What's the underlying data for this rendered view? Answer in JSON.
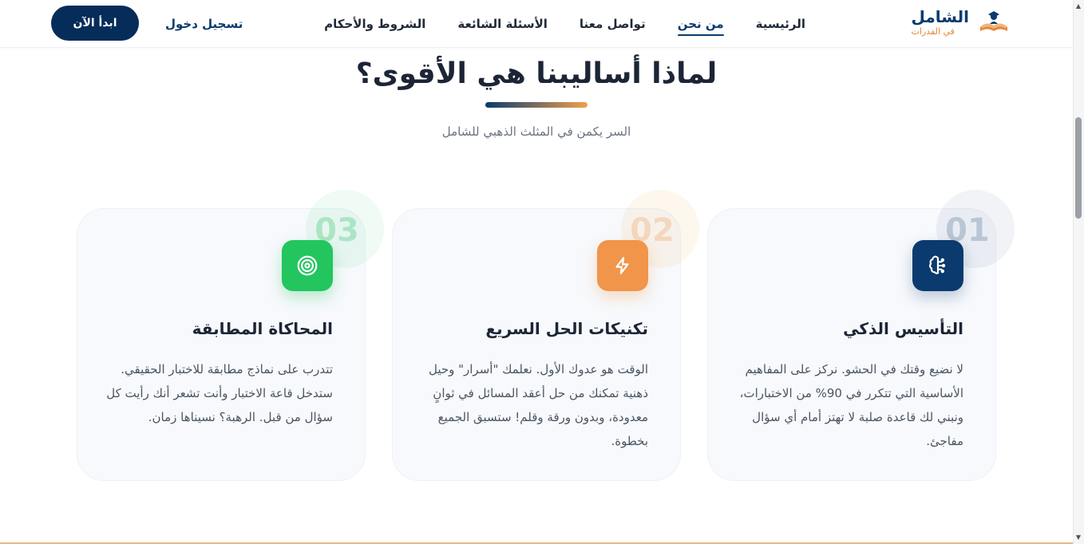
{
  "nav": {
    "logo_main": "الشامل",
    "logo_sub": "في القدرات",
    "links": [
      {
        "label": "الرئيسية"
      },
      {
        "label": "من نحن"
      },
      {
        "label": "تواصل معنا"
      },
      {
        "label": "الأسئلة الشائعة"
      },
      {
        "label": "الشروط والأحكام"
      }
    ],
    "active_link": "من نحن",
    "login": "تسجيل دخول",
    "start": "ابدأ الآن"
  },
  "section": {
    "title": "لماذا أساليبنا هي الأقوى؟",
    "subtitle": "السر يكمن في المثلث الذهبي للشامل"
  },
  "cards": [
    {
      "number": "01",
      "icon": "brain-icon",
      "color": "#0b3a6e",
      "title": "التأسيس الذكي",
      "body": "لا نضيع وقتك في الحشو. نركز على المفاهيم الأساسية التي تتكرر في 90% من الاختبارات، ونبني لك قاعدة صلبة لا تهتز أمام أي سؤال مفاجئ."
    },
    {
      "number": "02",
      "icon": "lightning-icon",
      "color": "#f0954a",
      "title": "تكنيكات الحل السريع",
      "body": "الوقت هو عدوك الأول. نعلمك \"أسرار\" وحيل ذهنية تمكنك من حل أعقد المسائل في ثوانٍ معدودة، وبدون ورقة وقلم! ستسبق الجميع بخطوة."
    },
    {
      "number": "03",
      "icon": "target-icon",
      "color": "#22c55e",
      "title": "المحاكاة المطابقة",
      "body": "تتدرب على نماذج مطابقة للاختبار الحقيقي. ستدخل قاعة الاختبار وأنت تشعر أنك رأيت كل سؤال من قبل. الرهبة؟ نسيناها زمان."
    }
  ]
}
